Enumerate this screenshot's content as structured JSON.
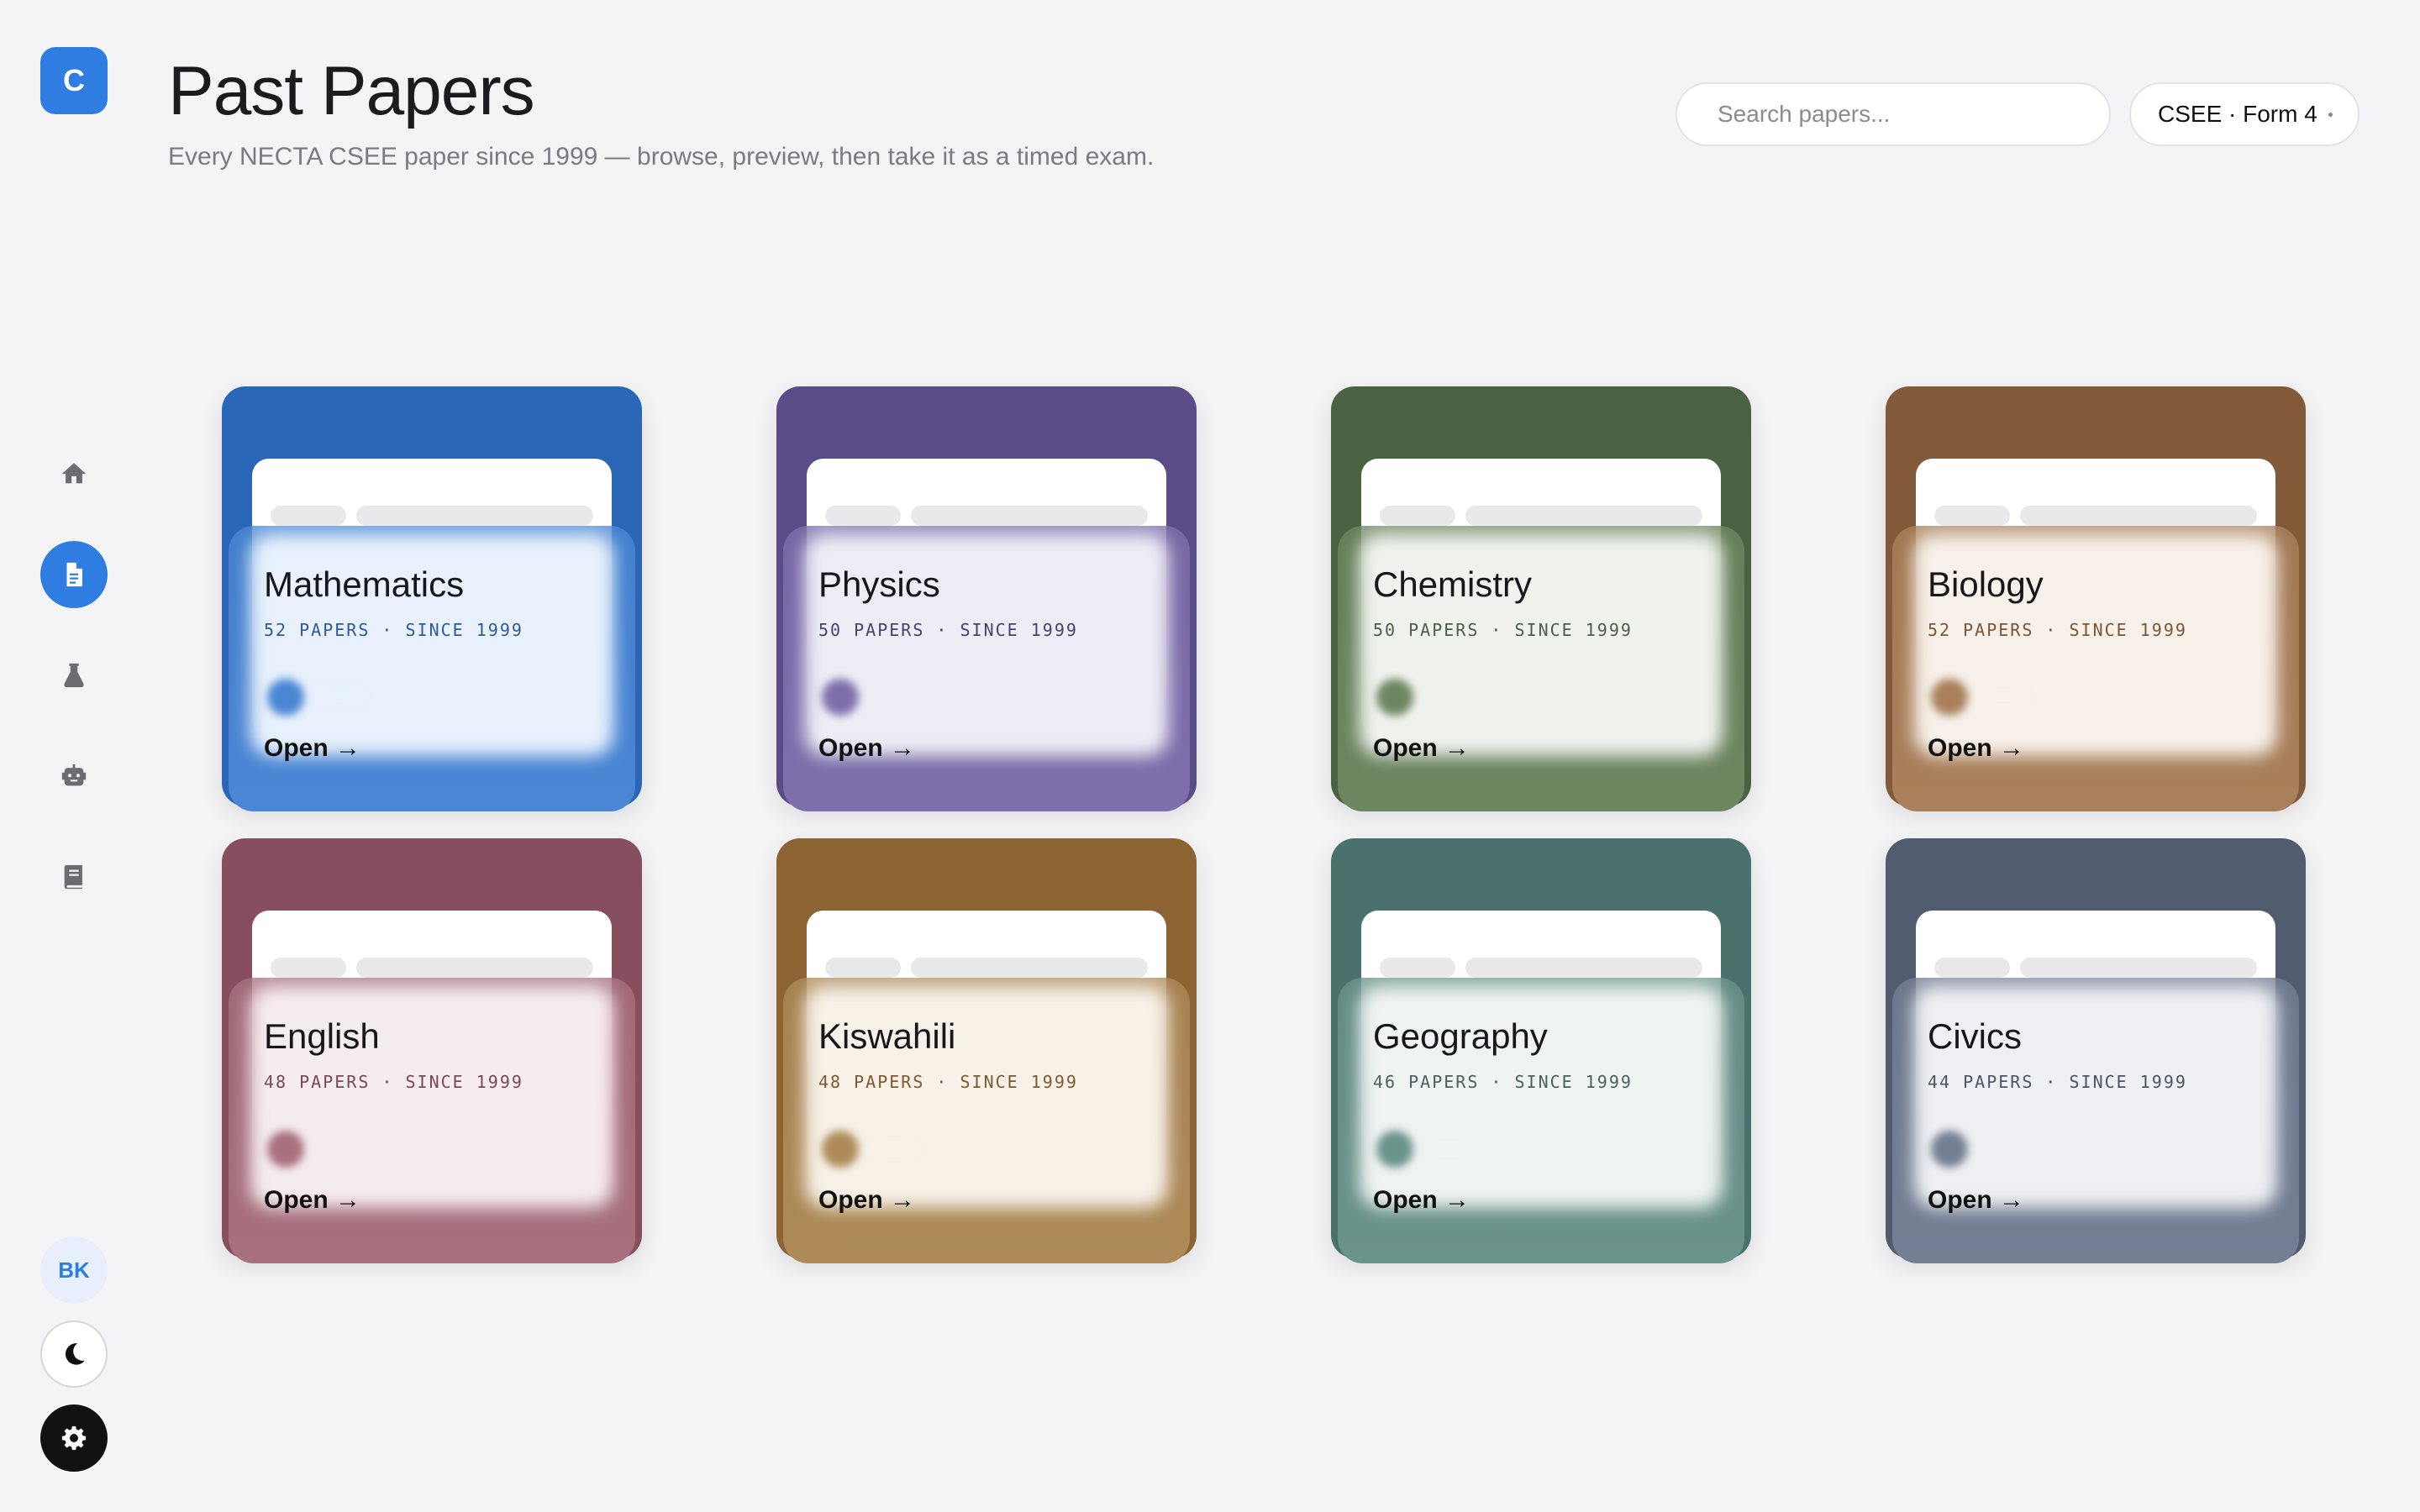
{
  "app": {
    "logo_letter": "C"
  },
  "header": {
    "title": "Past Papers",
    "subtitle": "Every NECTA CSEE paper since 1999 — browse, preview, then take it as a timed exam.",
    "search_placeholder": "Search papers...",
    "filter_label": "CSEE · Form 4"
  },
  "sidebar": {
    "items": [
      {
        "icon": "home-icon",
        "active": false
      },
      {
        "icon": "document-icon",
        "active": true
      },
      {
        "icon": "flask-icon",
        "active": false
      },
      {
        "icon": "robot-icon",
        "active": false
      },
      {
        "icon": "book-icon",
        "active": false
      }
    ],
    "user_initials": "BK",
    "theme_icon": "moon-icon",
    "settings_icon": "gear-icon"
  },
  "open_label": "Open →",
  "subjects": [
    {
      "name": "Mathematics",
      "meta": "52 PAPERS · SINCE 1999",
      "back": "#2a66b6",
      "front": "#4a86d4",
      "glass": "#e8f1fc",
      "meta_color": "#2d5a9a"
    },
    {
      "name": "Physics",
      "meta": "50 PAPERS · SINCE 1999",
      "back": "#5a4c86",
      "front": "#7e6fac",
      "glass": "#eeedf5",
      "meta_color": "#4a4070"
    },
    {
      "name": "Chemistry",
      "meta": "50 PAPERS · SINCE 1999",
      "back": "#4a6242",
      "front": "#6d8660",
      "glass": "#f0f2ee",
      "meta_color": "#4b5f45"
    },
    {
      "name": "Biology",
      "meta": "52 PAPERS · SINCE 1999",
      "back": "#825a3a",
      "front": "#a9805b",
      "glass": "#f7f1ea",
      "meta_color": "#7a5535"
    },
    {
      "name": "English",
      "meta": "48 PAPERS · SINCE 1999",
      "back": "#864e5e",
      "front": "#a8707f",
      "glass": "#f5ecee",
      "meta_color": "#7a4757"
    },
    {
      "name": "Kiswahili",
      "meta": "48 PAPERS · SINCE 1999",
      "back": "#8c6332",
      "front": "#ad8a58",
      "glass": "#f7f1e8",
      "meta_color": "#7c5a30"
    },
    {
      "name": "Geography",
      "meta": "46 PAPERS · SINCE 1999",
      "back": "#4a716c",
      "front": "#6a938b",
      "glass": "#eff3f2",
      "meta_color": "#46625e"
    },
    {
      "name": "Civics",
      "meta": "44 PAPERS · SINCE 1999",
      "back": "#515d6f",
      "front": "#747f94",
      "glass": "#eff0f3",
      "meta_color": "#4a5466"
    }
  ]
}
